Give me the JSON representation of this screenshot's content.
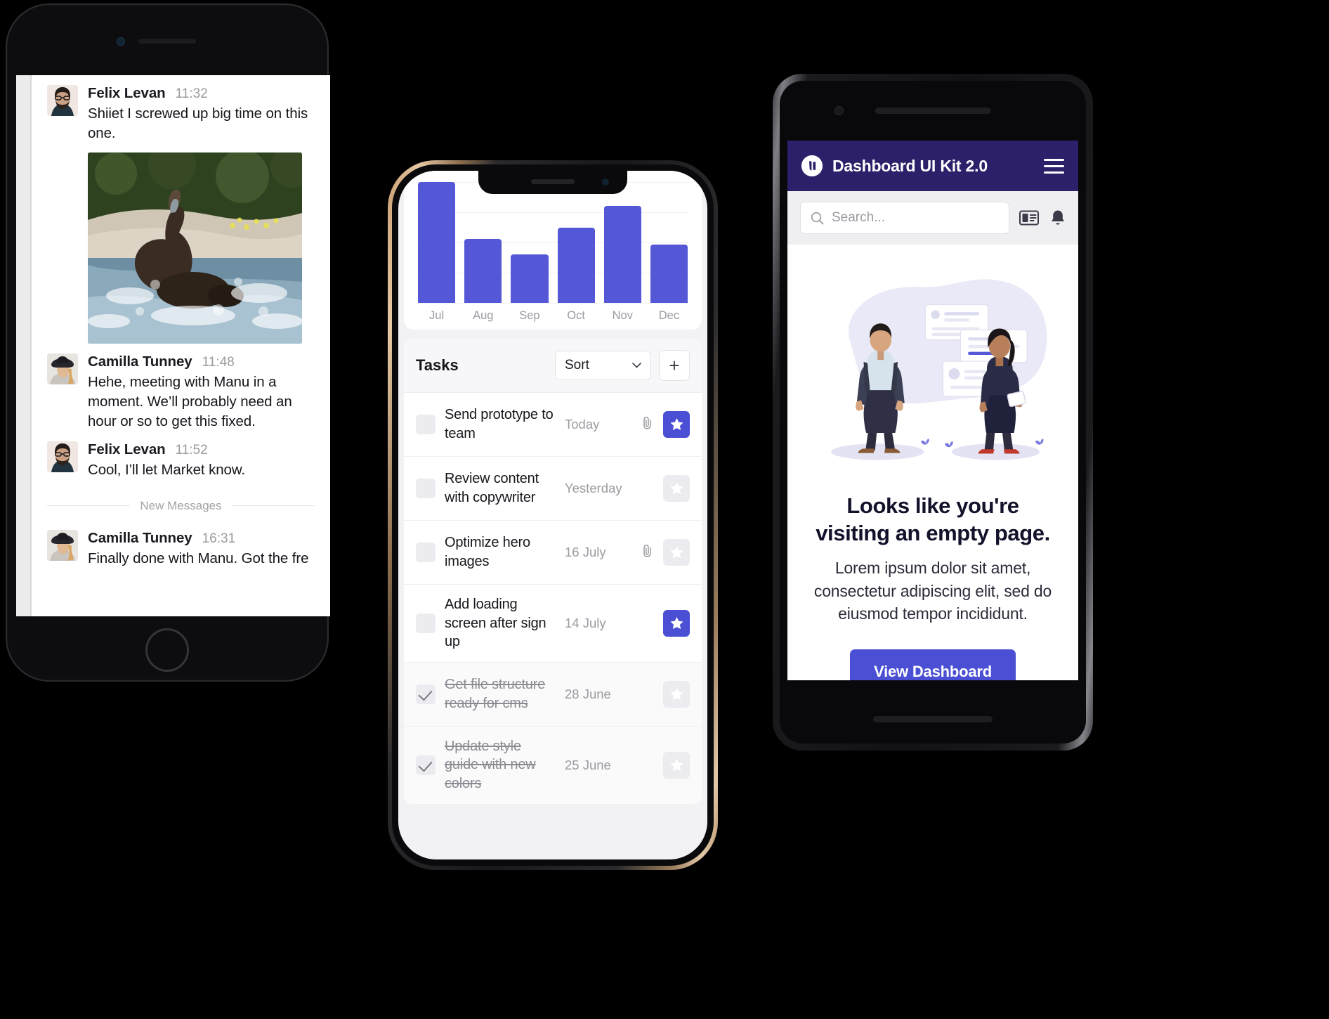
{
  "chat": {
    "new_divider_label": "New Messages",
    "messages": [
      {
        "name": "Felix Levan",
        "time": "11:32",
        "text": "Shiiet I screwed up big time on this one.",
        "avatar": "man-glasses-beard-avatar",
        "has_photo": true,
        "photo_alt": "bear-splashing-in-water-photo"
      },
      {
        "name": "Camilla Tunney",
        "time": "11:48",
        "text": "Hehe, meeting with Manu in a moment. We’ll probably need an hour or so to get this fixed.",
        "avatar": "woman-hat-avatar",
        "has_photo": false
      },
      {
        "name": "Felix Levan",
        "time": "11:52",
        "text": "Cool, I’ll let Market know.",
        "avatar": "man-glasses-beard-avatar",
        "has_photo": false
      },
      {
        "name": "Camilla Tunney",
        "time": "16:31",
        "text": "Finally done with Manu. Got the fre",
        "avatar": "woman-hat-avatar",
        "has_photo": false
      }
    ]
  },
  "tasks_app": {
    "section_title": "Tasks",
    "sort_label": "Sort",
    "add_label": "+",
    "rows": [
      {
        "label": "Send prototype to team",
        "date": "Today",
        "attachment": true,
        "starred": true,
        "done": false
      },
      {
        "label": "Review content with copywriter",
        "date": "Yesterday",
        "attachment": false,
        "starred": false,
        "done": false
      },
      {
        "label": "Optimize hero images",
        "date": "16 July",
        "attachment": true,
        "starred": false,
        "done": false
      },
      {
        "label": "Add loading screen after sign up",
        "date": "14 July",
        "attachment": false,
        "starred": true,
        "done": false
      },
      {
        "label": "Get file structure ready for cms",
        "date": "28 June",
        "attachment": false,
        "starred": false,
        "done": true
      },
      {
        "label": "Update style guide with new colors",
        "date": "25 June",
        "attachment": false,
        "starred": false,
        "done": true
      }
    ]
  },
  "chart_data": {
    "type": "bar",
    "title": "",
    "categories": [
      "Jul",
      "Aug",
      "Sep",
      "Oct",
      "Nov",
      "Dec"
    ],
    "values": [
      100,
      53,
      40,
      62,
      80,
      48
    ],
    "ylim": [
      0,
      100
    ],
    "xlabel": "",
    "ylabel": "",
    "grid": true,
    "legend": "none",
    "bar_color": "#5458d6"
  },
  "dashboard": {
    "title": "Dashboard UI Kit 2.0",
    "logo_icon": "dashboard-logo-icon",
    "menu_icon": "hamburger-menu-icon",
    "search_placeholder": "Search...",
    "search_value": "",
    "search_icon": "search-icon",
    "card_icon": "cards-view-icon",
    "bell_icon": "bell-icon",
    "empty_title": "Looks like you're visiting an empty page.",
    "empty_subtitle": "Lorem ipsum dolor sit amet, consectetur adipiscing elit, sed do eiusmod tempor incididunt.",
    "cta_label": "View Dashboard",
    "illustration_alt": "two-people-with-floating-cards-illustration",
    "accent": "#4a4fd4",
    "header_bg": "#2b2069"
  }
}
